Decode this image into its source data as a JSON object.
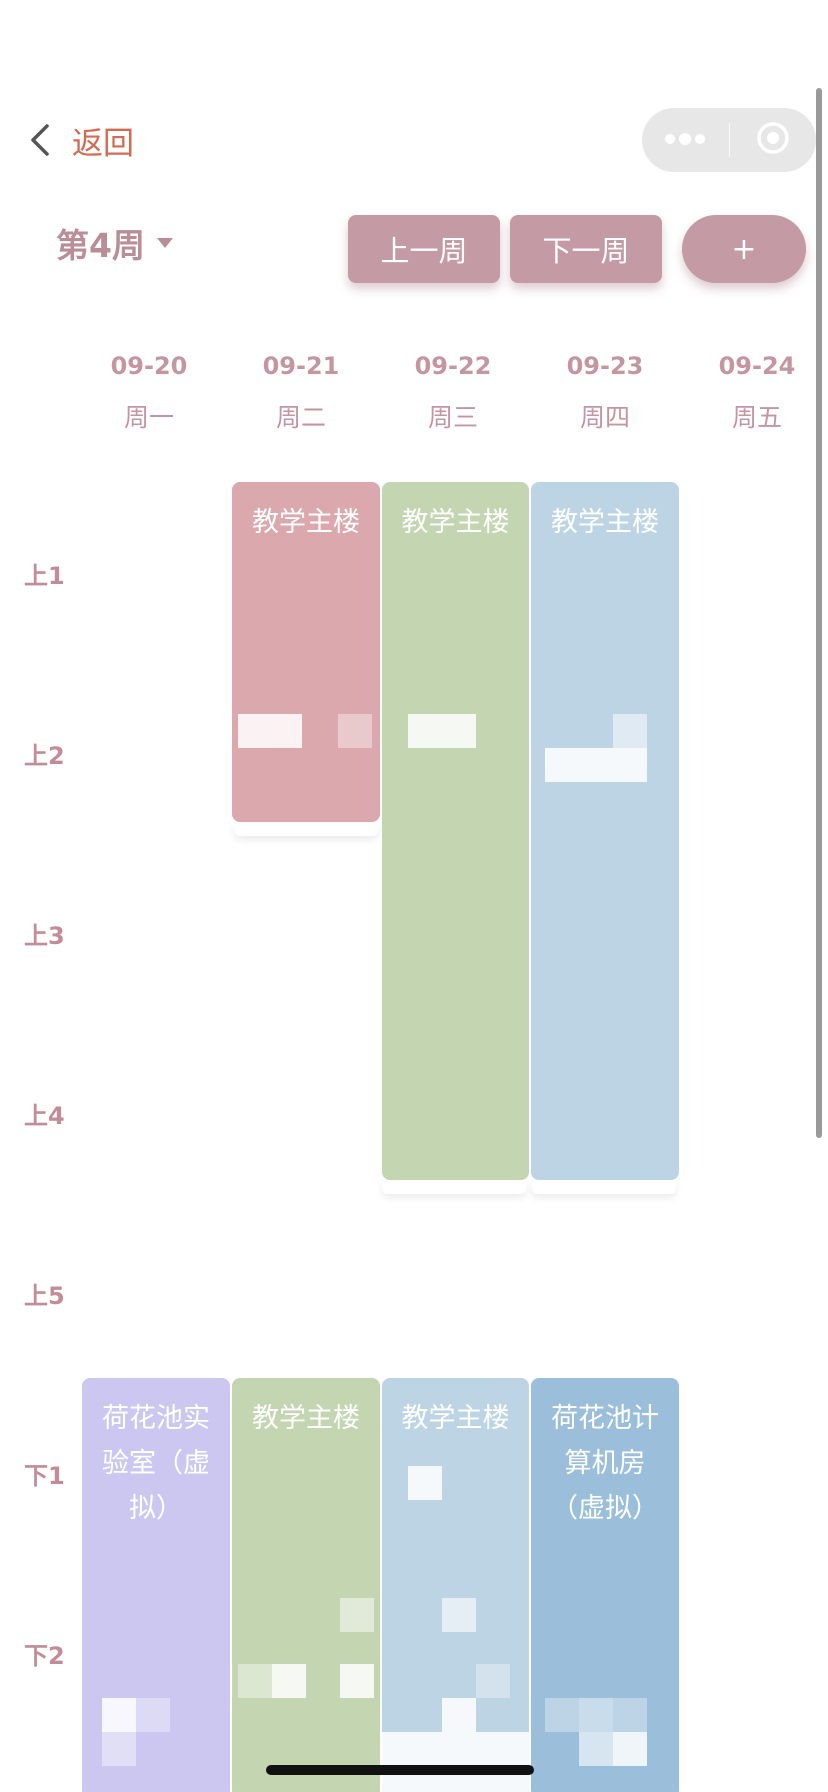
{
  "header": {
    "back_label": "返回",
    "back_icon": "chevron-left-icon",
    "capsule_more_icon": "more-dots-icon",
    "capsule_close_icon": "target-circle-icon"
  },
  "toolbar": {
    "week_label": "第4周",
    "prev_week_label": "上一周",
    "next_week_label": "下一周",
    "add_label": "+"
  },
  "days": [
    {
      "date": "09-20",
      "weekday": "周一"
    },
    {
      "date": "09-21",
      "weekday": "周二"
    },
    {
      "date": "09-22",
      "weekday": "周三"
    },
    {
      "date": "09-23",
      "weekday": "周四"
    },
    {
      "date": "09-24",
      "weekday": "周五"
    }
  ],
  "periods": [
    "上1",
    "上2",
    "上3",
    "上4",
    "上5",
    "下1",
    "下2"
  ],
  "courses": [
    {
      "day": "周二",
      "title": "教学主楼",
      "color": "#dba9ad"
    },
    {
      "day": "周三",
      "title": "教学主楼",
      "color": "#c3d5b1"
    },
    {
      "day": "周四",
      "title": "教学主楼",
      "color": "#bdd4e4"
    },
    {
      "day": "周一",
      "title": "荷花池实验室（虚拟）",
      "color": "#cbc7f0"
    },
    {
      "day": "周二",
      "title": "教学主楼",
      "color": "#c3d5b1"
    },
    {
      "day": "周三",
      "title": "教学主楼",
      "color": "#bdd4e4"
    },
    {
      "day": "周四",
      "title": "荷花池计算机房（虚拟）",
      "color": "#9bbedb"
    }
  ],
  "colors": {
    "accent": "#c49aa4",
    "back_text": "#d46a52",
    "header_text": "#c496a3"
  }
}
